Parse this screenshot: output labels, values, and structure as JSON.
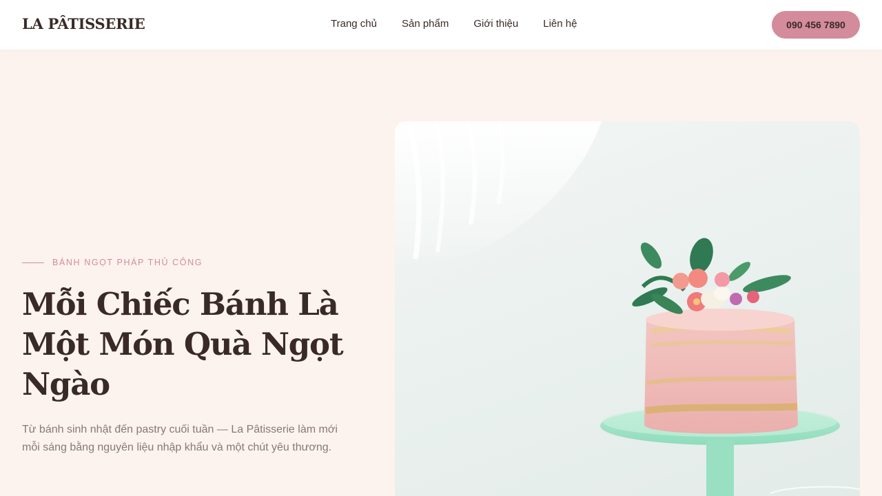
{
  "nav": {
    "brand": "LA PÂTISSERIE",
    "links": [
      "Trang chủ",
      "Sản phẩm",
      "Giới thiệu",
      "Liên hệ"
    ],
    "phone": "090 456 7890"
  },
  "hero": {
    "eyebrow": "BÁNH NGỌT PHÁP THỦ CÔNG",
    "title_lines": [
      "Mỗi Chiếc Bánh Là",
      "Một Món Quà Ngọt",
      "Ngào"
    ],
    "description": "Từ bánh sinh nhật đến pastry cuối tuần — La Pâtisserie làm mới mỗi sáng bằng nguyên liệu nhập khẩu và một chút yêu thương."
  },
  "colors": {
    "accent": "#d48b9b",
    "background": "#fcf3ef",
    "text": "#3a2a27",
    "muted_text": "#8a7773"
  }
}
